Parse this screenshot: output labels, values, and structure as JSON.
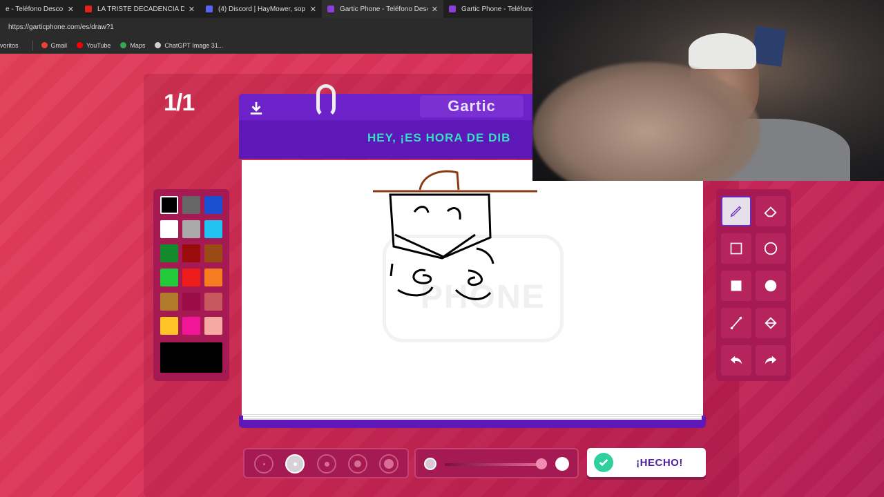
{
  "browser": {
    "tabs": [
      {
        "title": "e - Teléfono Descomp",
        "color": "#7b3cc8",
        "active": false
      },
      {
        "title": "LA TRISTE DECADENCIA DE KICK",
        "color": "#e62117",
        "active": false
      },
      {
        "title": "(4) Discord | HayMower, sop",
        "color": "#5865f2",
        "active": false
      },
      {
        "title": "Gartic Phone - Teléfono Descomp",
        "color": "#8a3fd6",
        "active": true
      },
      {
        "title": "Gartic Phone - Teléfono De",
        "color": "#8a3fd6",
        "active": false
      }
    ],
    "url": "https://garticphone.com/es/draw?1",
    "bookmarks": [
      {
        "label": "voritos",
        "color": ""
      },
      {
        "label": "Gmail",
        "color": "#ea4335"
      },
      {
        "label": "YouTube",
        "color": "#ff0000"
      },
      {
        "label": "Maps",
        "color": "#34a853"
      },
      {
        "label": "ChatGPT Image 31...",
        "color": "#cfcfcf"
      }
    ]
  },
  "game": {
    "round": "1/1",
    "logo": "Gartic",
    "prompt": "HEY, ¡ES HORA DE DIB",
    "watermark": "PHONE",
    "done_label": "¡HECHO!"
  },
  "palette": {
    "colors": [
      "#000000",
      "#666666",
      "#1a4fcf",
      "#ffffff",
      "#aaaaaa",
      "#22c3f2",
      "#138a2c",
      "#9a0b0b",
      "#9a4a14",
      "#21c93b",
      "#ef1c1c",
      "#f57d1f",
      "#b17a2c",
      "#9b0d47",
      "#c8585f",
      "#fec327",
      "#f01697",
      "#f6a8a2"
    ],
    "selected": "#000000"
  },
  "tools": [
    "pencil-icon",
    "eraser-icon",
    "rectangle-outline-icon",
    "circle-outline-icon",
    "rectangle-fill-icon",
    "circle-fill-icon",
    "line-icon",
    "fill-bucket-icon",
    "undo-icon",
    "redo-icon"
  ],
  "brush": {
    "selected_size_index": 1,
    "opacity": 1.0
  }
}
